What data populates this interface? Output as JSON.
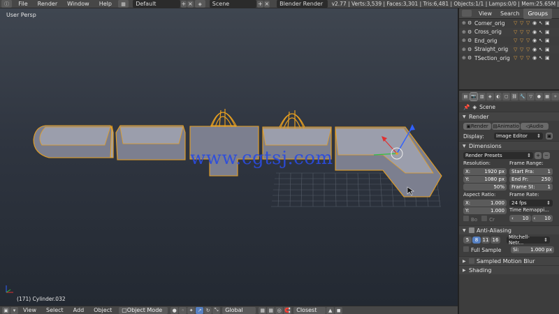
{
  "topbar": {
    "menus": [
      "File",
      "Render",
      "Window",
      "Help"
    ],
    "layout": "Default",
    "scene": "Scene",
    "engine": "Blender Render",
    "stats": "v2.77 | Verts:3,539 | Faces:3,301 | Tris:6,481 | Objects:1/1 | Lamps:0/0 | Mem:25.65M |"
  },
  "viewport": {
    "label": "User Persp",
    "object_label": "(171) Cylinder.032",
    "watermark": "www.cgtsj.com"
  },
  "bottombar": {
    "menus": [
      "View",
      "Select",
      "Add",
      "Object"
    ],
    "mode": "Object Mode",
    "orientation": "Global",
    "snap": "Closest"
  },
  "outliner": {
    "tabs": [
      "View",
      "Search",
      "Groups"
    ],
    "active_tab": "Groups",
    "items": [
      "Corner_orig",
      "Cross_orig",
      "End_orig",
      "Straight_orig",
      "TSection_orig"
    ]
  },
  "properties": {
    "context": "Scene",
    "render": {
      "title": "Render",
      "buttons": [
        "Render",
        "Animatio",
        "Audio"
      ],
      "display_label": "Display:",
      "display_value": "Image Editor"
    },
    "dimensions": {
      "title": "Dimensions",
      "presets": "Render Presets",
      "resolution_label": "Resolution:",
      "res_x_label": "X:",
      "res_x": "1920 px",
      "res_y_label": "Y:",
      "res_y": "1080 px",
      "res_pct": "50%",
      "frame_range_label": "Frame Range:",
      "start_label": "Start Fra:",
      "start": "1",
      "end_label": "End Fr:",
      "end": "250",
      "step_label": "Frame St:",
      "step": "1",
      "aspect_label": "Aspect Ratio:",
      "aspect_x_label": "X:",
      "aspect_x": "1.000",
      "aspect_y_label": "Y:",
      "aspect_y": "1.000",
      "framerate_label": "Frame Rate:",
      "framerate": "24 fps",
      "remap_label": "Time Remappi...",
      "remap_old": "10",
      "remap_new": "10",
      "border_label": "Bo",
      "crop_label": "Cr"
    },
    "antialiasing": {
      "title": "Anti-Aliasing",
      "samples": [
        "5",
        "8",
        "11",
        "16"
      ],
      "active_sample": "8",
      "filter": "Mitchell-Netr...",
      "full_sample": "Full Sample",
      "size_label": "Si:",
      "size": "1.000 px"
    },
    "collapsed_panels": [
      "Sampled Motion Blur",
      "Shading"
    ]
  }
}
